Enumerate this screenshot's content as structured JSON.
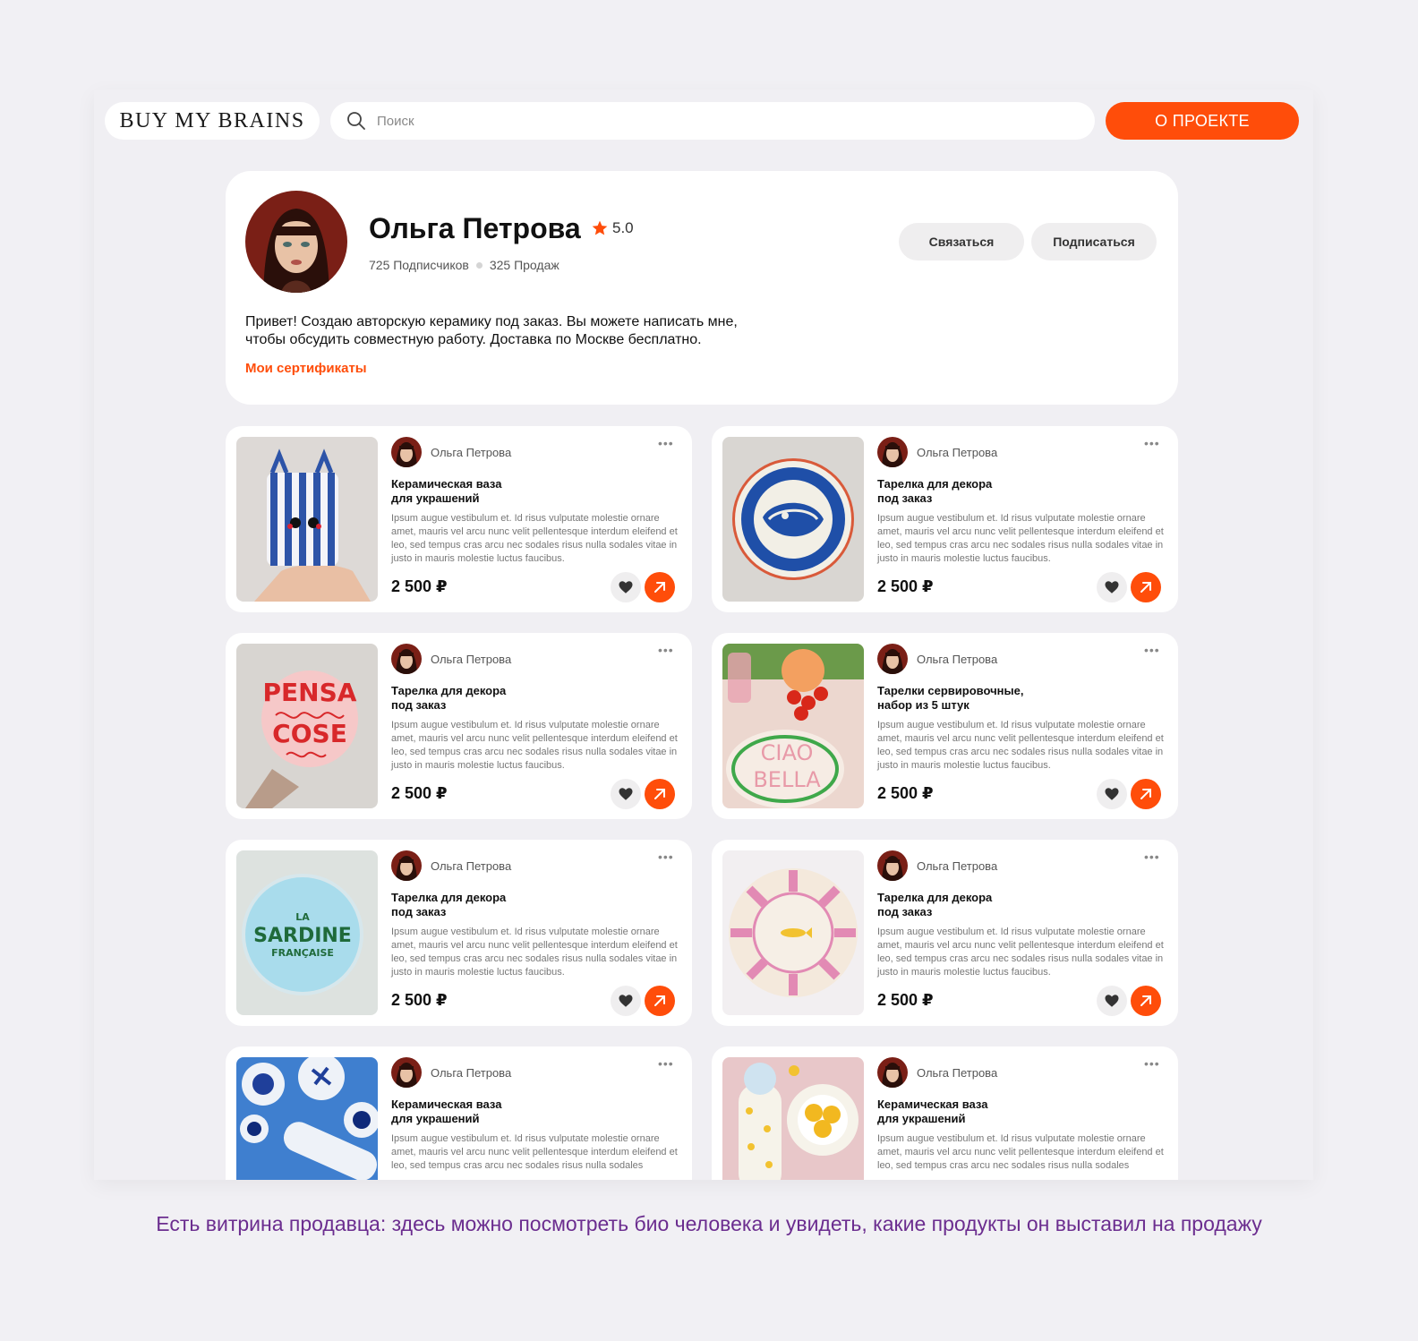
{
  "header": {
    "logo": "BUY MY BRAINS",
    "search_placeholder": "Поиск",
    "about_label": "О ПРОЕКТЕ"
  },
  "profile": {
    "name": "Ольга Петрова",
    "rating": "5.0",
    "subscribers": "725 Подписчиков",
    "sales": "325 Продаж",
    "contact_label": "Связаться",
    "subscribe_label": "Подписаться",
    "bio_line1": "Привет! Создаю авторскую керамику под заказ. Вы можете написать мне,",
    "bio_line2": "чтобы обсудить совместную работу. Доставка по Москве бесплатно.",
    "certificates_label": "Мои сертификаты"
  },
  "products": [
    {
      "author": "Ольга Петрова",
      "title": "Керамическая ваза\nдля украшений",
      "desc": "Ipsum augue vestibulum et. Id risus vulputate molestie ornare amet, mauris vel arcu nunc velit pellentesque interdum eleifend et leo, sed tempus cras arcu nec sodales risus nulla sodales vitae in justo in mauris molestie luctus faucibus.",
      "price": "2 500 ₽"
    },
    {
      "author": "Ольга Петрова",
      "title": "Тарелка для декора\nпод заказ",
      "desc": "Ipsum augue vestibulum et. Id risus vulputate molestie ornare amet, mauris vel arcu nunc velit pellentesque interdum eleifend et leo, sed tempus cras arcu nec sodales risus nulla sodales vitae in justo in mauris molestie luctus faucibus.",
      "price": "2 500 ₽"
    },
    {
      "author": "Ольга Петрова",
      "title": "Тарелка для декора\nпод заказ",
      "desc": "Ipsum augue vestibulum et. Id risus vulputate molestie ornare amet, mauris vel arcu nunc velit pellentesque interdum eleifend et leo, sed tempus cras arcu nec sodales risus nulla sodales vitae in justo in mauris molestie luctus faucibus.",
      "price": "2 500 ₽"
    },
    {
      "author": "Ольга Петрова",
      "title": "Тарелки сервировочные,\nнабор из 5 штук",
      "desc": "Ipsum augue vestibulum et. Id risus vulputate molestie ornare amet, mauris vel arcu nunc velit pellentesque interdum eleifend et leo, sed tempus cras arcu nec sodales risus nulla sodales vitae in justo in mauris molestie luctus faucibus.",
      "price": "2 500 ₽"
    },
    {
      "author": "Ольга Петрова",
      "title": "Тарелка для декора\nпод заказ",
      "desc": "Ipsum augue vestibulum et. Id risus vulputate molestie ornare amet, mauris vel arcu nunc velit pellentesque interdum eleifend et leo, sed tempus cras arcu nec sodales risus nulla sodales vitae in justo in mauris molestie luctus faucibus.",
      "price": "2 500 ₽"
    },
    {
      "author": "Ольга Петрова",
      "title": "Тарелка для декора\nпод заказ",
      "desc": "Ipsum augue vestibulum et. Id risus vulputate molestie ornare amet, mauris vel arcu nunc velit pellentesque interdum eleifend et leo, sed tempus cras arcu nec sodales risus nulla sodales vitae in justo in mauris molestie luctus faucibus.",
      "price": "2 500 ₽"
    },
    {
      "author": "Ольга Петрова",
      "title": "Керамическая ваза\nдля украшений",
      "desc": "Ipsum augue vestibulum et. Id risus vulputate molestie ornare amet, mauris vel arcu nunc velit pellentesque interdum eleifend et leo, sed tempus cras arcu nec sodales risus nulla sodales",
      "price": ""
    },
    {
      "author": "Ольга Петрова",
      "title": "Керамическая ваза\nдля украшений",
      "desc": "Ipsum augue vestibulum et. Id risus vulputate molestie ornare amet, mauris vel arcu nunc velit pellentesque interdum eleifend et leo, sed tempus cras arcu nec sodales risus nulla sodales",
      "price": ""
    }
  ],
  "image_texts": {
    "pensa_top": "PENSA",
    "pensa_bottom": "COSE",
    "ciao": "CIAO",
    "bella": "BELLA",
    "la": "LA",
    "sardine": "SARDINE",
    "francaise": "FRANÇAISE"
  },
  "caption": "Есть витрина продавца: здесь можно посмотреть био человека и увидеть, какие продукты он выставил на продажу",
  "colors": {
    "accent": "#ff4d0a",
    "caption": "#6b2d8f",
    "page_bg": "#f1f0f4"
  }
}
